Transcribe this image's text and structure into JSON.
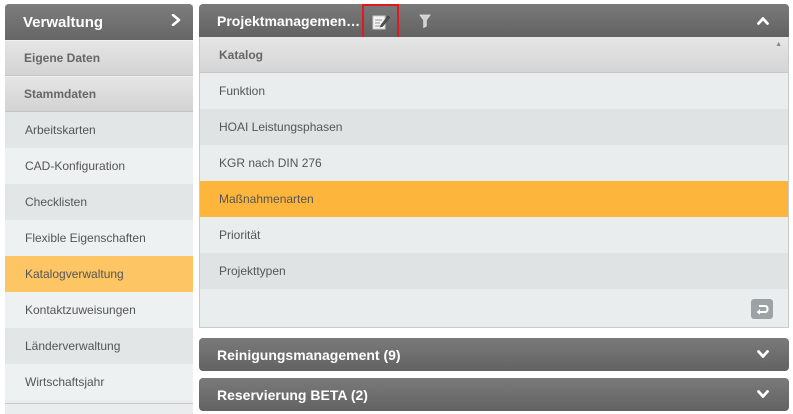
{
  "sidebar": {
    "title": "Verwaltung",
    "chevron": "›",
    "sections": [
      "Eigene Daten",
      "Stammdaten"
    ],
    "items": [
      {
        "label": "Arbeitskarten"
      },
      {
        "label": "CAD-Konfiguration"
      },
      {
        "label": "Checklisten"
      },
      {
        "label": "Flexible Eigenschaften"
      },
      {
        "label": "Katalogverwaltung",
        "active": true
      },
      {
        "label": "Kontaktzuweisungen"
      },
      {
        "label": "Länderverwaltung"
      },
      {
        "label": "Wirtschaftsjahr"
      }
    ]
  },
  "panels": {
    "projekt": {
      "title": "Projektmanagemen…",
      "column_header": "Katalog",
      "rows": [
        "Funktion",
        "HOAI Leistungsphasen",
        "KGR nach DIN 276",
        "Maßnahmenarten",
        "Priorität",
        "Projekttypen"
      ],
      "selected_row": "Maßnahmenarten"
    },
    "reinigung": {
      "title": "Reinigungsmanagement (9)"
    },
    "reservierung": {
      "title": "Reservierung BETA (2)"
    }
  },
  "icons": [
    "chevron-right-icon",
    "edit-icon",
    "filter-icon",
    "chevron-up-icon",
    "chevron-down-icon",
    "undo-icon",
    "scroll-up-icon"
  ],
  "colors": {
    "header": "#6e6e6e",
    "active_item": "#fec564",
    "selected_row": "#fdb53b",
    "highlight_border": "#e0191e"
  }
}
